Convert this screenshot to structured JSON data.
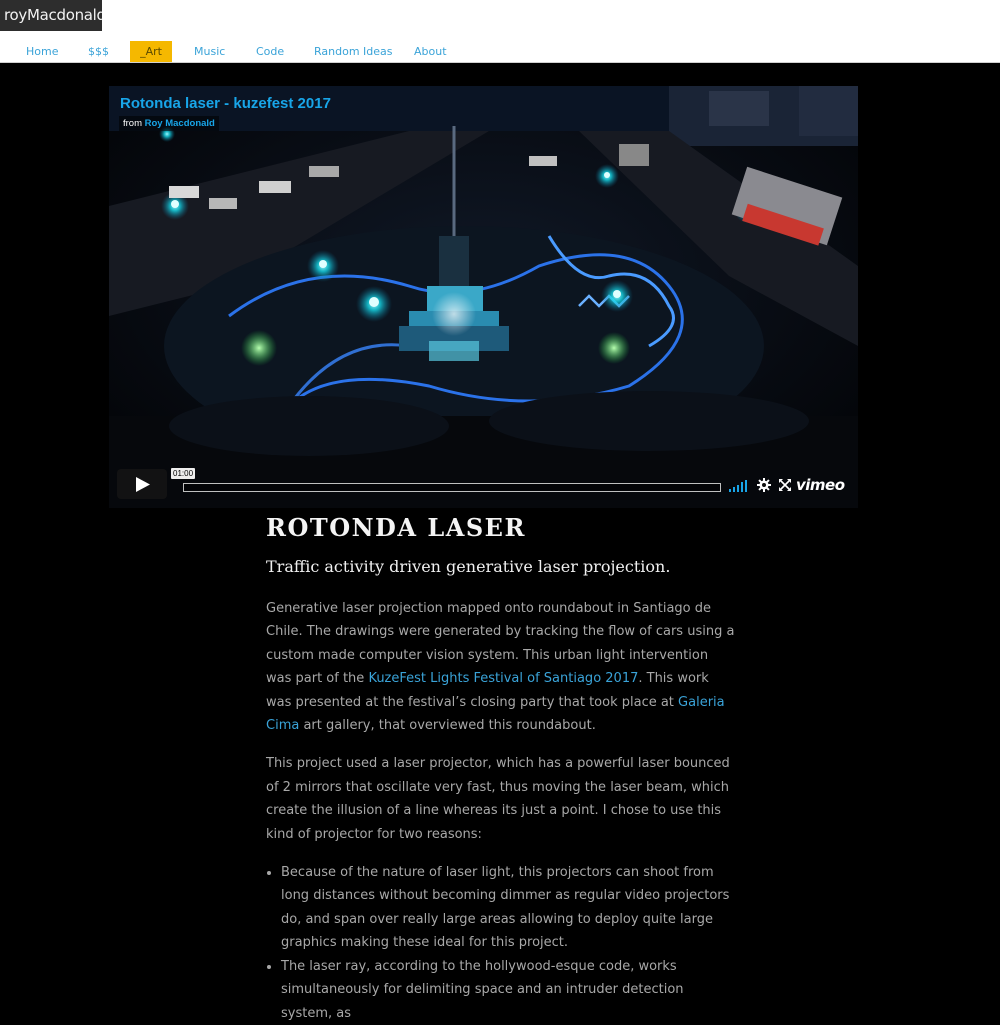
{
  "header": {
    "logo": "royMacdonald",
    "nav": [
      {
        "label": "Home",
        "active": false
      },
      {
        "label": "$$$",
        "active": false
      },
      {
        "label": "_Art",
        "active": true
      },
      {
        "label": "Music",
        "active": false
      },
      {
        "label": "Code",
        "active": false
      },
      {
        "label": "Random Ideas",
        "active": false
      },
      {
        "label": "About",
        "active": false
      }
    ],
    "accent_color": "#f5b800",
    "link_color": "#3aa3d8"
  },
  "video": {
    "title": "Rotonda laser - kuzefest 2017",
    "byline_prefix": "from",
    "author": "Roy Macdonald",
    "timecode": "01:00",
    "brand": "vimeo",
    "icons": [
      "play-icon",
      "volume-icon",
      "gear-icon",
      "fullscreen-icon"
    ]
  },
  "article": {
    "title": "ROTONDA LASER",
    "subtitle": "Traffic activity driven generative laser projection.",
    "p1": {
      "t1": "Generative laser projection mapped onto roundabout in Santiago de Chile. The drawings were generated by tracking the flow of cars using a custom made computer vision system. This urban light intervention was part of the ",
      "link1": "KuzeFest Lights Festival of Santiago 2017",
      "t2": ". This work was presented at the festival’s closing party that took place at ",
      "link2": "Galeria Cima",
      "t3": " art gallery, that overviewed this roundabout."
    },
    "p2": "This project used a laser projector, which has a powerful laser bounced of 2 mirrors that oscillate very fast, thus moving the laser beam, which create the illusion of a line whereas its just a point. I chose to use this kind of projector for two reasons:",
    "bullets": [
      "Because of the nature of laser light, this projectors can shoot from long distances without becoming dimmer as regular video projectors do, and span over really large areas allowing to deploy quite large graphics making these ideal for this project.",
      "The laser ray, according to the hollywood-esque code, works simultaneously for delimiting space and an intruder detection system, as"
    ]
  }
}
